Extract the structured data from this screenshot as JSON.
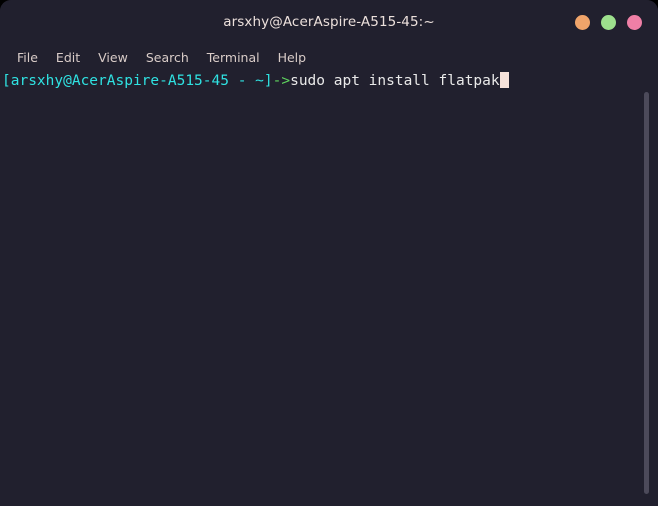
{
  "window": {
    "title": "arsxhy@AcerAspire-A515-45:~",
    "background_color": "#21202e",
    "outside_color": "#000000"
  },
  "window_controls": [
    {
      "name": "minimize",
      "label": "Minimize",
      "color": "#f0a46a"
    },
    {
      "name": "maximize",
      "label": "Maximize",
      "color": "#9de08d"
    },
    {
      "name": "close",
      "label": "Close",
      "color": "#ef7fa6"
    }
  ],
  "menubar": {
    "items": [
      {
        "label": "File"
      },
      {
        "label": "Edit"
      },
      {
        "label": "View"
      },
      {
        "label": "Search"
      },
      {
        "label": "Terminal"
      },
      {
        "label": "Help"
      }
    ],
    "text_color": "#d9ccc8"
  },
  "terminal": {
    "foreground_color": "#e9e9e9",
    "prompt_color": "#2fe2e2",
    "arrow_color": "#5fd45f",
    "cursor_color": "#f6e2da",
    "lines": [
      {
        "segments": [
          {
            "text": "[arsxhy@AcerAspire-A515-45 - ~]",
            "color": "#2fe2e2"
          },
          {
            "text": "->",
            "color": "#5fd45f"
          },
          {
            "text": "sudo apt install flatpak",
            "color": "#e9e9e9"
          }
        ],
        "cursor": true
      }
    ],
    "prompt_user": "arsxhy",
    "prompt_host": "AcerAspire-A515-45",
    "prompt_path": "~",
    "command": "sudo apt install flatpak"
  },
  "scrollbar": {
    "thumb_color": "#4c4a5a",
    "position": "right"
  }
}
